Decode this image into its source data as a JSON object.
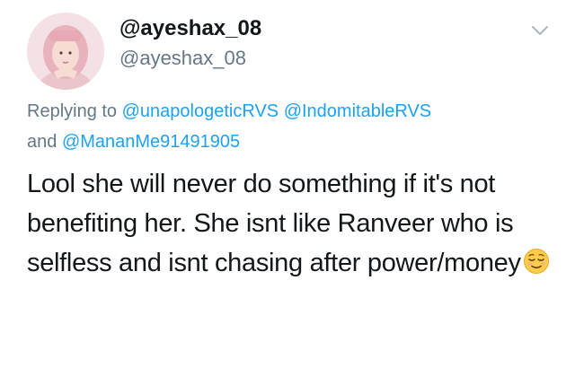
{
  "tweet": {
    "display_name": "@ayeshax_08",
    "handle": "@ayeshax_08",
    "reply_prefix": "Replying to",
    "reply_mentions": [
      "@unapologeticRVS",
      "@IndomitableRVS"
    ],
    "reply_and": "and",
    "reply_last_mention": "@MananMe91491905",
    "text": "Lool she will never do something if it's not benefiting her. She isnt like Ranveer who is selfless and isnt chasing after power/money",
    "emoji": "relieved-face-emoji"
  },
  "icons": {
    "menu": "chevron-down-icon",
    "avatar": "profile-avatar"
  },
  "colors": {
    "link": "#1da1f2",
    "secondary_text": "#657786",
    "primary_text": "#14171a",
    "chevron": "#aab8c2"
  }
}
